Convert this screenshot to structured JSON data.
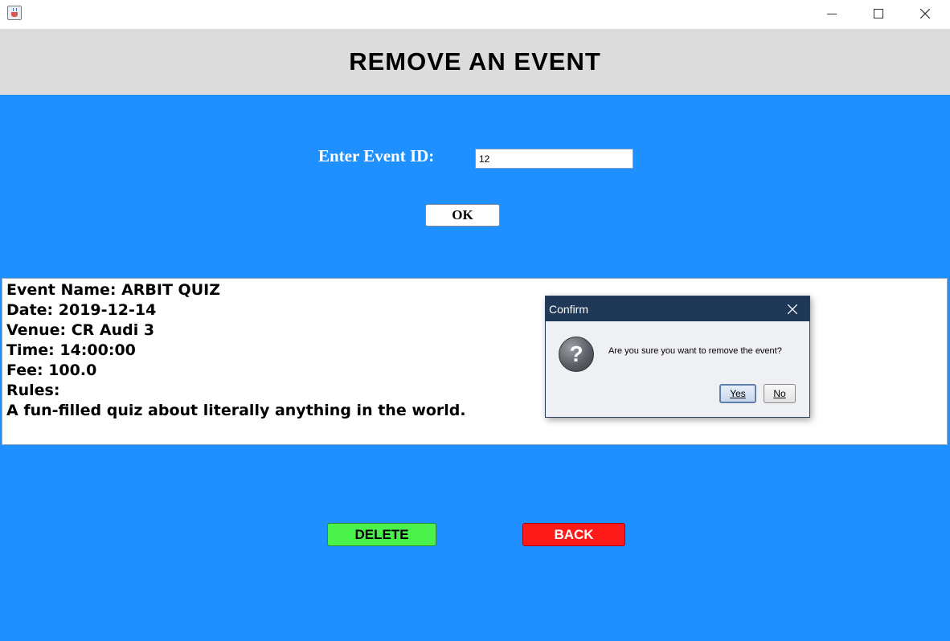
{
  "window": {
    "icon": "java-cup-icon",
    "controls": [
      "minimize-icon",
      "maximize-icon",
      "close-icon"
    ]
  },
  "header": {
    "title": "REMOVE AN EVENT"
  },
  "form": {
    "event_id_label": "Enter Event ID:",
    "event_id_value": "12",
    "ok_label": "OK"
  },
  "event_info": {
    "lines": [
      "Event Name: ARBIT QUIZ",
      "Date: 2019-12-14",
      "Venue: CR Audi 3",
      "Time: 14:00:00",
      "Fee: 100.0",
      "Rules:",
      "A fun-filled quiz about literally anything in the world."
    ]
  },
  "actions": {
    "delete_label": "DELETE",
    "back_label": "BACK"
  },
  "dialog": {
    "title": "Confirm",
    "icon": "question-icon",
    "message": "Are you sure you want to remove the event?",
    "yes_label": "Yes",
    "no_label": "No"
  },
  "colors": {
    "background": "#1e90ff",
    "header_band": "#dcdcdc",
    "delete_button": "#4cf24c",
    "back_button": "#ff1a1a",
    "dialog_title_bar": "#1f3858"
  }
}
